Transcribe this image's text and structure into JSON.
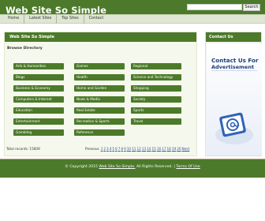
{
  "header": {
    "site_title": "Web Site So Simple",
    "search_button": "Search"
  },
  "nav": {
    "items": [
      "Home",
      "Latest Sites",
      "Top Sites",
      "Contact"
    ]
  },
  "main": {
    "panel_title": "Web Site So Simple",
    "section_title": "Browse Directory",
    "categories": [
      "Arts & Humanities",
      "Games",
      "Regional",
      "Blogs",
      "Health",
      "Science and Technology",
      "Business & Economy",
      "Home and Garden",
      "Shopping",
      "Computers & Internet",
      "News & Media",
      "Society",
      "Education",
      "Real Estate",
      "Sports",
      "Entertainment",
      "Recreation & Sports",
      "Travel",
      "Gambling",
      "Reference"
    ],
    "total_label": "Total records: 15609",
    "pager": {
      "prev_label": "Previous",
      "pages": [
        "1",
        "2",
        "3",
        "4",
        "5",
        "6",
        "7",
        "8",
        "9",
        "10",
        "11",
        "12",
        "13",
        "14",
        "15",
        "16",
        "17",
        "18",
        "19",
        "20"
      ],
      "next_label": "Next"
    }
  },
  "sidebar": {
    "title": "Contact Us",
    "ad_line1": "Contact Us For",
    "ad_line2": "Advertisement"
  },
  "footer": {
    "copyright": "© Copyright 2015",
    "site_link": "Web Site So Simple.",
    "rights": "All Rights Reserved. |",
    "terms_link": "Terms Of Use"
  },
  "colors": {
    "brand_green": "#4c7a2a",
    "nav_bg": "#dfe6d3",
    "ad_blue": "#1f3c7c"
  }
}
